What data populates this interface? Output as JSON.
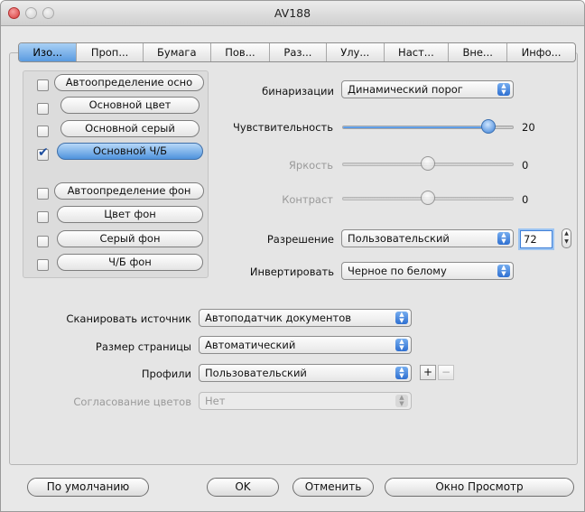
{
  "window": {
    "title": "AV188"
  },
  "tabs": [
    "Изо...",
    "Проп...",
    "Бумага",
    "Пов...",
    "Раз...",
    "Улу...",
    "Наст...",
    "Вне...",
    "Инфо..."
  ],
  "detect": [
    {
      "label": "Автоопределение осно",
      "checked": false,
      "selected": false
    },
    {
      "label": "Основной цвет",
      "checked": false,
      "selected": false
    },
    {
      "label": "Основной серый",
      "checked": false,
      "selected": false
    },
    {
      "label": "Основной Ч/Б",
      "checked": true,
      "selected": true
    },
    {
      "label": "Автоопределение фон",
      "checked": false,
      "selected": false
    },
    {
      "label": "Цвет фон",
      "checked": false,
      "selected": false
    },
    {
      "label": "Серый фон",
      "checked": false,
      "selected": false
    },
    {
      "label": "Ч/Б фон",
      "checked": false,
      "selected": false
    }
  ],
  "settings": {
    "binarization": {
      "label": "бинаризации",
      "value": "Динамический порог"
    },
    "sensitivity": {
      "label": "Чувствительность",
      "value": "20",
      "level": 0.85
    },
    "brightness": {
      "label": "Яркость",
      "value": "0",
      "level": 0.5
    },
    "contrast": {
      "label": "Контраст",
      "value": "0",
      "level": 0.5
    },
    "resolution": {
      "label": "Разрешение",
      "value": "Пользовательский",
      "field": "72"
    },
    "invert": {
      "label": "Инвертировать",
      "value": "Черное по белому"
    }
  },
  "scan": {
    "source": {
      "label": "Сканировать источник",
      "value": "Автоподатчик документов"
    },
    "page_size": {
      "label": "Размер страницы",
      "value": "Автоматический"
    },
    "profiles": {
      "label": "Профили",
      "value": "Пользовательский",
      "add": "+",
      "remove": "−"
    },
    "color_match": {
      "label": "Согласование цветов",
      "value": "Нет"
    }
  },
  "buttons": {
    "defaults": "По умолчанию",
    "ok": "OK",
    "cancel": "Отменить",
    "preview": "Окно Просмотр"
  },
  "colors": {
    "accent": "#4f93dd"
  }
}
